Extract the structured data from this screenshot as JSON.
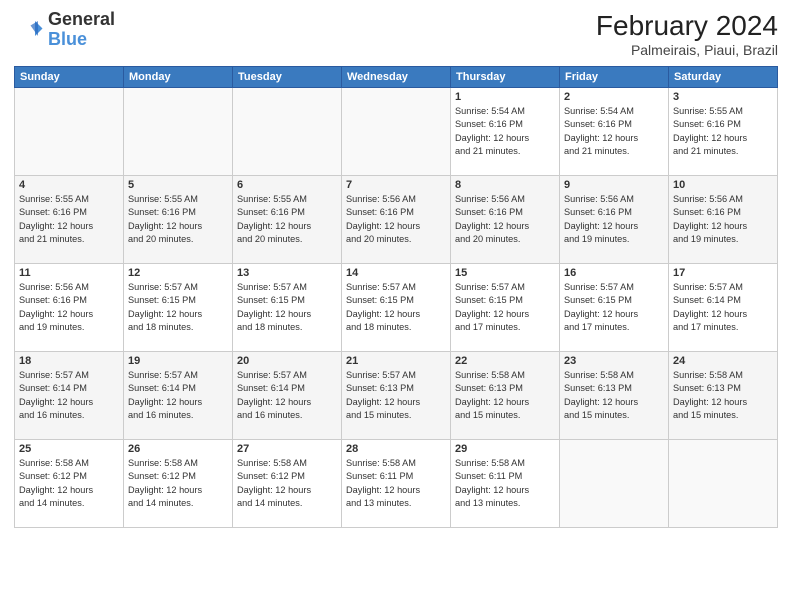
{
  "header": {
    "logo_general": "General",
    "logo_blue": "Blue",
    "month": "February 2024",
    "location": "Palmeirais, Piaui, Brazil"
  },
  "days_of_week": [
    "Sunday",
    "Monday",
    "Tuesday",
    "Wednesday",
    "Thursday",
    "Friday",
    "Saturday"
  ],
  "weeks": [
    [
      {
        "day": "",
        "info": ""
      },
      {
        "day": "",
        "info": ""
      },
      {
        "day": "",
        "info": ""
      },
      {
        "day": "",
        "info": ""
      },
      {
        "day": "1",
        "info": "Sunrise: 5:54 AM\nSunset: 6:16 PM\nDaylight: 12 hours\nand 21 minutes."
      },
      {
        "day": "2",
        "info": "Sunrise: 5:54 AM\nSunset: 6:16 PM\nDaylight: 12 hours\nand 21 minutes."
      },
      {
        "day": "3",
        "info": "Sunrise: 5:55 AM\nSunset: 6:16 PM\nDaylight: 12 hours\nand 21 minutes."
      }
    ],
    [
      {
        "day": "4",
        "info": "Sunrise: 5:55 AM\nSunset: 6:16 PM\nDaylight: 12 hours\nand 21 minutes."
      },
      {
        "day": "5",
        "info": "Sunrise: 5:55 AM\nSunset: 6:16 PM\nDaylight: 12 hours\nand 20 minutes."
      },
      {
        "day": "6",
        "info": "Sunrise: 5:55 AM\nSunset: 6:16 PM\nDaylight: 12 hours\nand 20 minutes."
      },
      {
        "day": "7",
        "info": "Sunrise: 5:56 AM\nSunset: 6:16 PM\nDaylight: 12 hours\nand 20 minutes."
      },
      {
        "day": "8",
        "info": "Sunrise: 5:56 AM\nSunset: 6:16 PM\nDaylight: 12 hours\nand 20 minutes."
      },
      {
        "day": "9",
        "info": "Sunrise: 5:56 AM\nSunset: 6:16 PM\nDaylight: 12 hours\nand 19 minutes."
      },
      {
        "day": "10",
        "info": "Sunrise: 5:56 AM\nSunset: 6:16 PM\nDaylight: 12 hours\nand 19 minutes."
      }
    ],
    [
      {
        "day": "11",
        "info": "Sunrise: 5:56 AM\nSunset: 6:16 PM\nDaylight: 12 hours\nand 19 minutes."
      },
      {
        "day": "12",
        "info": "Sunrise: 5:57 AM\nSunset: 6:15 PM\nDaylight: 12 hours\nand 18 minutes."
      },
      {
        "day": "13",
        "info": "Sunrise: 5:57 AM\nSunset: 6:15 PM\nDaylight: 12 hours\nand 18 minutes."
      },
      {
        "day": "14",
        "info": "Sunrise: 5:57 AM\nSunset: 6:15 PM\nDaylight: 12 hours\nand 18 minutes."
      },
      {
        "day": "15",
        "info": "Sunrise: 5:57 AM\nSunset: 6:15 PM\nDaylight: 12 hours\nand 17 minutes."
      },
      {
        "day": "16",
        "info": "Sunrise: 5:57 AM\nSunset: 6:15 PM\nDaylight: 12 hours\nand 17 minutes."
      },
      {
        "day": "17",
        "info": "Sunrise: 5:57 AM\nSunset: 6:14 PM\nDaylight: 12 hours\nand 17 minutes."
      }
    ],
    [
      {
        "day": "18",
        "info": "Sunrise: 5:57 AM\nSunset: 6:14 PM\nDaylight: 12 hours\nand 16 minutes."
      },
      {
        "day": "19",
        "info": "Sunrise: 5:57 AM\nSunset: 6:14 PM\nDaylight: 12 hours\nand 16 minutes."
      },
      {
        "day": "20",
        "info": "Sunrise: 5:57 AM\nSunset: 6:14 PM\nDaylight: 12 hours\nand 16 minutes."
      },
      {
        "day": "21",
        "info": "Sunrise: 5:57 AM\nSunset: 6:13 PM\nDaylight: 12 hours\nand 15 minutes."
      },
      {
        "day": "22",
        "info": "Sunrise: 5:58 AM\nSunset: 6:13 PM\nDaylight: 12 hours\nand 15 minutes."
      },
      {
        "day": "23",
        "info": "Sunrise: 5:58 AM\nSunset: 6:13 PM\nDaylight: 12 hours\nand 15 minutes."
      },
      {
        "day": "24",
        "info": "Sunrise: 5:58 AM\nSunset: 6:13 PM\nDaylight: 12 hours\nand 15 minutes."
      }
    ],
    [
      {
        "day": "25",
        "info": "Sunrise: 5:58 AM\nSunset: 6:12 PM\nDaylight: 12 hours\nand 14 minutes."
      },
      {
        "day": "26",
        "info": "Sunrise: 5:58 AM\nSunset: 6:12 PM\nDaylight: 12 hours\nand 14 minutes."
      },
      {
        "day": "27",
        "info": "Sunrise: 5:58 AM\nSunset: 6:12 PM\nDaylight: 12 hours\nand 14 minutes."
      },
      {
        "day": "28",
        "info": "Sunrise: 5:58 AM\nSunset: 6:11 PM\nDaylight: 12 hours\nand 13 minutes."
      },
      {
        "day": "29",
        "info": "Sunrise: 5:58 AM\nSunset: 6:11 PM\nDaylight: 12 hours\nand 13 minutes."
      },
      {
        "day": "",
        "info": ""
      },
      {
        "day": "",
        "info": ""
      }
    ]
  ]
}
